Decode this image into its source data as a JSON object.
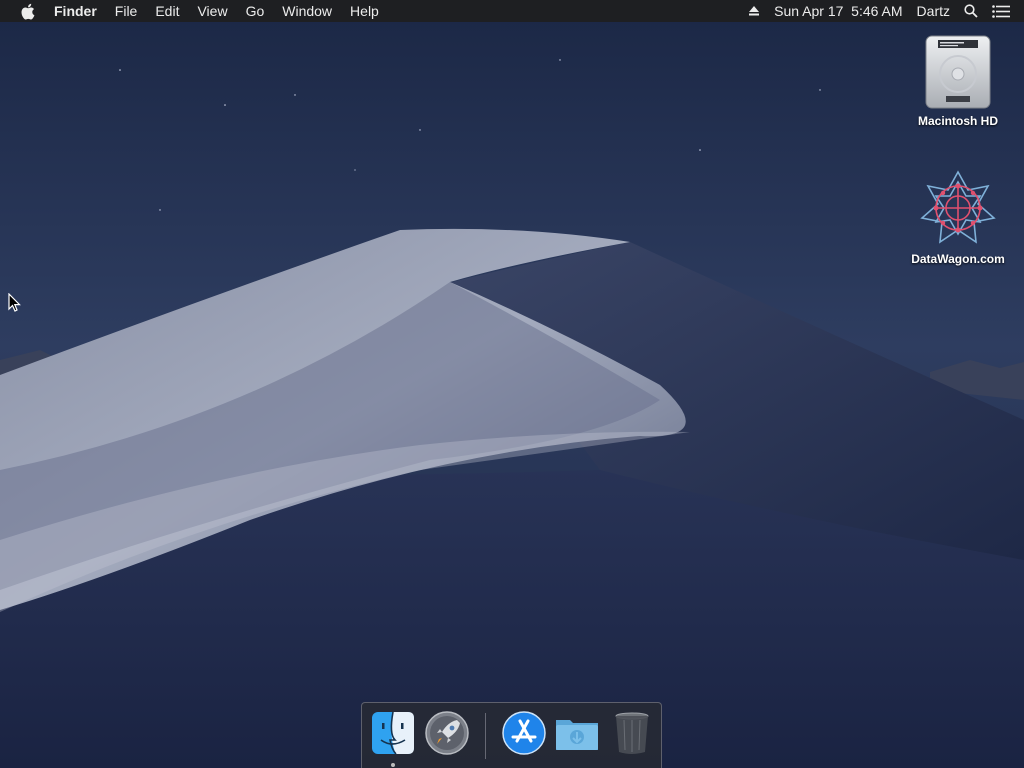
{
  "menubar": {
    "app_name": "Finder",
    "menus": [
      "File",
      "Edit",
      "View",
      "Go",
      "Window",
      "Help"
    ],
    "clock": "Sun Apr 17  5:46 AM",
    "user": "Dartz"
  },
  "desktop": {
    "icons": [
      {
        "label": "Macintosh HD"
      },
      {
        "label": "DataWagon.com"
      }
    ]
  },
  "dock": {
    "items": [
      {
        "icon": "finder-icon",
        "running": true
      },
      {
        "icon": "launchpad-icon",
        "running": false
      },
      {
        "icon": "app-store-icon",
        "running": false
      },
      {
        "icon": "downloads-folder-icon",
        "running": false
      },
      {
        "icon": "trash-icon",
        "running": false
      }
    ]
  },
  "colors": {
    "menubar_bg": "#1e1e20",
    "sky_top": "#1b2745",
    "sky_bottom": "#2d3c5e",
    "dune_light": "#a6adc0"
  }
}
